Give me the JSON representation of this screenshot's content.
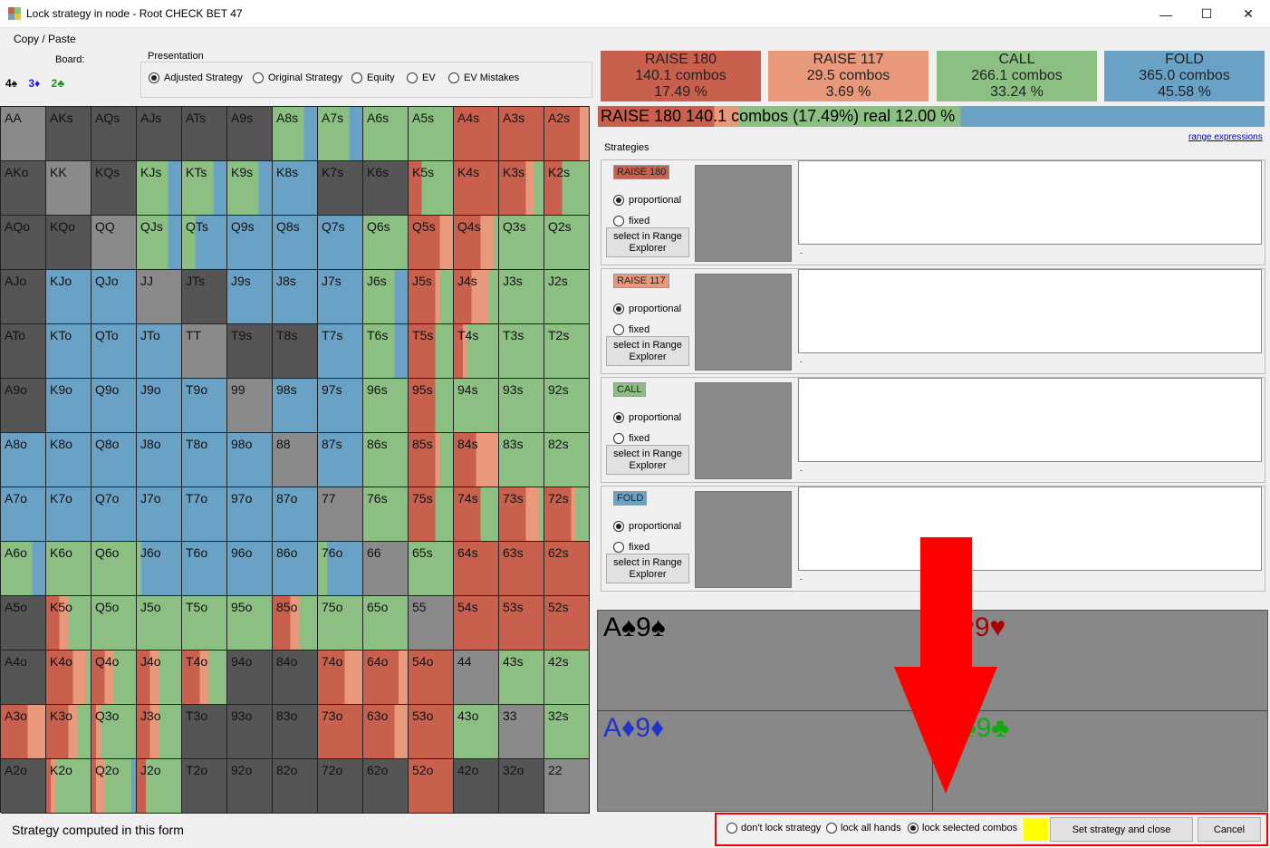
{
  "window": {
    "title": "Lock strategy in node  - Root CHECK BET 47",
    "minimize": "—",
    "maximize": "☐",
    "close": "✕"
  },
  "menu": {
    "copy_paste": "Copy / Paste"
  },
  "board": {
    "label": "Board:",
    "cards": [
      {
        "text": "4♠",
        "color": "#000000"
      },
      {
        "text": "3♦",
        "color": "#2222dd"
      },
      {
        "text": "2♣",
        "color": "#119911"
      }
    ]
  },
  "presentation": {
    "title": "Presentation",
    "options": [
      {
        "label": "Adjusted Strategy",
        "selected": true
      },
      {
        "label": "Original Strategy",
        "selected": false
      },
      {
        "label": "Equity",
        "selected": false
      },
      {
        "label": "EV",
        "selected": false
      },
      {
        "label": "EV Mistakes",
        "selected": false
      }
    ]
  },
  "colors": {
    "raise180": "#c9604e",
    "raise117": "#e8987b",
    "call": "#8cc083",
    "fold": "#6aa2c6",
    "empty": "#555555",
    "pair_empty": "#8a8a8a",
    "lock_color": "#ffff00"
  },
  "hands": [
    [
      "AA",
      "AKs",
      "AQs",
      "AJs",
      "ATs",
      "A9s",
      "A8s",
      "A7s",
      "A6s",
      "A5s",
      "A4s",
      "A3s",
      "A2s"
    ],
    [
      "AKo",
      "KK",
      "KQs",
      "KJs",
      "KTs",
      "K9s",
      "K8s",
      "K7s",
      "K6s",
      "K5s",
      "K4s",
      "K3s",
      "K2s"
    ],
    [
      "AQo",
      "KQo",
      "QQ",
      "QJs",
      "QTs",
      "Q9s",
      "Q8s",
      "Q7s",
      "Q6s",
      "Q5s",
      "Q4s",
      "Q3s",
      "Q2s"
    ],
    [
      "AJo",
      "KJo",
      "QJo",
      "JJ",
      "JTs",
      "J9s",
      "J8s",
      "J7s",
      "J6s",
      "J5s",
      "J4s",
      "J3s",
      "J2s"
    ],
    [
      "ATo",
      "KTo",
      "QTo",
      "JTo",
      "TT",
      "T9s",
      "T8s",
      "T7s",
      "T6s",
      "T5s",
      "T4s",
      "T3s",
      "T2s"
    ],
    [
      "A9o",
      "K9o",
      "Q9o",
      "J9o",
      "T9o",
      "99",
      "98s",
      "97s",
      "96s",
      "95s",
      "94s",
      "93s",
      "92s"
    ],
    [
      "A8o",
      "K8o",
      "Q8o",
      "J8o",
      "T8o",
      "98o",
      "88",
      "87s",
      "86s",
      "85s",
      "84s",
      "83s",
      "82s"
    ],
    [
      "A7o",
      "K7o",
      "Q7o",
      "J7o",
      "T7o",
      "97o",
      "87o",
      "77",
      "76s",
      "75s",
      "74s",
      "73s",
      "72s"
    ],
    [
      "A6o",
      "K6o",
      "Q6o",
      "J6o",
      "T6o",
      "96o",
      "86o",
      "76o",
      "66",
      "65s",
      "64s",
      "63s",
      "62s"
    ],
    [
      "A5o",
      "K5o",
      "Q5o",
      "J5o",
      "T5o",
      "95o",
      "85o",
      "75o",
      "65o",
      "55",
      "54s",
      "53s",
      "52s"
    ],
    [
      "A4o",
      "K4o",
      "Q4o",
      "J4o",
      "T4o",
      "94o",
      "84o",
      "74o",
      "64o",
      "54o",
      "44",
      "43s",
      "42s"
    ],
    [
      "A3o",
      "K3o",
      "Q3o",
      "J3o",
      "T3o",
      "93o",
      "83o",
      "73o",
      "63o",
      "53o",
      "43o",
      "33",
      "32s"
    ],
    [
      "A2o",
      "K2o",
      "Q2o",
      "J2o",
      "T2o",
      "92o",
      "82o",
      "72o",
      "62o",
      "52o",
      "42o",
      "32o",
      "22"
    ]
  ],
  "hand_mix_legend": "frequencies per hand as [raise180, raise117, call, fold]",
  "hand_mix": [
    [
      [
        0,
        0,
        0,
        0
      ],
      [
        0,
        0,
        0,
        0
      ],
      [
        0,
        0,
        0,
        0
      ],
      [
        0,
        0,
        0,
        0
      ],
      [
        0,
        0,
        0,
        0
      ],
      [
        0,
        0,
        0,
        0
      ],
      [
        0,
        0,
        0.7,
        0.3
      ],
      [
        0,
        0,
        0.7,
        0.3
      ],
      [
        0,
        0,
        1,
        0
      ],
      [
        0,
        0,
        1,
        0
      ],
      [
        1,
        0,
        0,
        0
      ],
      [
        1,
        0,
        0,
        0
      ],
      [
        0.8,
        0.2,
        0,
        0
      ]
    ],
    [
      [
        0,
        0,
        0,
        0
      ],
      [
        0,
        0,
        0,
        0
      ],
      [
        0,
        0,
        0,
        0
      ],
      [
        0,
        0,
        0.7,
        0.3
      ],
      [
        0,
        0,
        0.7,
        0.3
      ],
      [
        0,
        0,
        0.7,
        0.3
      ],
      [
        0,
        0,
        0,
        1
      ],
      [
        0,
        0,
        0,
        0
      ],
      [
        0,
        0,
        0,
        0
      ],
      [
        0.3,
        0,
        0.7,
        0
      ],
      [
        1,
        0,
        0,
        0
      ],
      [
        0.6,
        0.2,
        0.2,
        0
      ],
      [
        0.4,
        0,
        0.6,
        0
      ]
    ],
    [
      [
        0,
        0,
        0,
        0
      ],
      [
        0,
        0,
        0,
        0
      ],
      [
        0,
        0,
        0,
        0
      ],
      [
        0,
        0,
        0.7,
        0.3
      ],
      [
        0,
        0,
        0.3,
        0.7
      ],
      [
        0,
        0,
        0,
        1
      ],
      [
        0,
        0,
        0,
        1
      ],
      [
        0,
        0,
        0,
        1
      ],
      [
        0,
        0,
        1,
        0
      ],
      [
        0.7,
        0.3,
        0,
        0
      ],
      [
        0.6,
        0.3,
        0.1,
        0
      ],
      [
        0,
        0,
        1,
        0
      ],
      [
        0,
        0,
        1,
        0
      ]
    ],
    [
      [
        0,
        0,
        0,
        0
      ],
      [
        0,
        0,
        0,
        1
      ],
      [
        0,
        0,
        0,
        1
      ],
      [
        0,
        0,
        0,
        0
      ],
      [
        0,
        0,
        0,
        0
      ],
      [
        0,
        0,
        0,
        1
      ],
      [
        0,
        0,
        0,
        1
      ],
      [
        0,
        0,
        0,
        1
      ],
      [
        0,
        0,
        0.7,
        0.3
      ],
      [
        0.6,
        0.1,
        0.3,
        0
      ],
      [
        0.4,
        0.4,
        0.2,
        0
      ],
      [
        0,
        0,
        1,
        0
      ],
      [
        0,
        0,
        1,
        0
      ]
    ],
    [
      [
        0,
        0,
        0,
        0
      ],
      [
        0,
        0,
        0,
        1
      ],
      [
        0,
        0,
        0,
        1
      ],
      [
        0,
        0,
        0,
        1
      ],
      [
        0,
        0,
        0,
        0
      ],
      [
        0,
        0,
        0,
        0
      ],
      [
        0,
        0,
        0,
        0
      ],
      [
        0,
        0,
        0,
        1
      ],
      [
        0,
        0,
        0.7,
        0.3
      ],
      [
        0.6,
        0,
        0.4,
        0
      ],
      [
        0.2,
        0.1,
        0.7,
        0
      ],
      [
        0,
        0,
        1,
        0
      ],
      [
        0,
        0,
        1,
        0
      ]
    ],
    [
      [
        0,
        0,
        0,
        0
      ],
      [
        0,
        0,
        0,
        1
      ],
      [
        0,
        0,
        0,
        1
      ],
      [
        0,
        0,
        0,
        1
      ],
      [
        0,
        0,
        0,
        1
      ],
      [
        0,
        0,
        0,
        0
      ],
      [
        0,
        0,
        0,
        1
      ],
      [
        0,
        0,
        0,
        1
      ],
      [
        0,
        0,
        1,
        0
      ],
      [
        0.6,
        0,
        0.4,
        0
      ],
      [
        0,
        0,
        1,
        0
      ],
      [
        0,
        0,
        1,
        0
      ],
      [
        0,
        0,
        1,
        0
      ]
    ],
    [
      [
        0,
        0,
        0,
        1
      ],
      [
        0,
        0,
        0,
        1
      ],
      [
        0,
        0,
        0,
        1
      ],
      [
        0,
        0,
        0,
        1
      ],
      [
        0,
        0,
        0,
        1
      ],
      [
        0,
        0,
        0,
        1
      ],
      [
        0,
        0,
        0,
        0
      ],
      [
        0,
        0,
        0,
        1
      ],
      [
        0,
        0,
        1,
        0
      ],
      [
        0.6,
        0.1,
        0.3,
        0
      ],
      [
        0.5,
        0.5,
        0,
        0
      ],
      [
        0,
        0,
        1,
        0
      ],
      [
        0,
        0,
        1,
        0
      ]
    ],
    [
      [
        0,
        0,
        0,
        1
      ],
      [
        0,
        0,
        0,
        1
      ],
      [
        0,
        0,
        0,
        1
      ],
      [
        0,
        0,
        0,
        1
      ],
      [
        0,
        0,
        0,
        1
      ],
      [
        0,
        0,
        0,
        1
      ],
      [
        0,
        0,
        0,
        1
      ],
      [
        0,
        0,
        0,
        0
      ],
      [
        0,
        0,
        1,
        0
      ],
      [
        0.6,
        0,
        0.4,
        0
      ],
      [
        0.6,
        0,
        0.4,
        0
      ],
      [
        0.6,
        0.3,
        0.1,
        0
      ],
      [
        0.6,
        0.1,
        0.3,
        0
      ]
    ],
    [
      [
        0,
        0,
        0.7,
        0.3
      ],
      [
        0,
        0,
        1,
        0
      ],
      [
        0,
        0,
        1,
        0
      ],
      [
        0,
        0,
        0.1,
        0.9
      ],
      [
        0,
        0,
        0,
        1
      ],
      [
        0,
        0,
        0,
        1
      ],
      [
        0,
        0,
        0,
        1
      ],
      [
        0,
        0,
        0.2,
        0.8
      ],
      [
        0,
        0,
        0,
        0
      ],
      [
        0,
        0,
        1,
        0
      ],
      [
        1,
        0,
        0,
        0
      ],
      [
        1,
        0,
        0,
        0
      ],
      [
        1,
        0,
        0,
        0
      ]
    ],
    [
      [
        0,
        0,
        0,
        0
      ],
      [
        0.3,
        0.2,
        0.5,
        0
      ],
      [
        0,
        0,
        1,
        0
      ],
      [
        0,
        0,
        1,
        0
      ],
      [
        0,
        0,
        1,
        0
      ],
      [
        0,
        0,
        1,
        0
      ],
      [
        0.4,
        0.2,
        0.4,
        0
      ],
      [
        0,
        0,
        1,
        0
      ],
      [
        0,
        0,
        1,
        0
      ],
      [
        0,
        0,
        0,
        0
      ],
      [
        1,
        0,
        0,
        0
      ],
      [
        1,
        0,
        0,
        0
      ],
      [
        1,
        0,
        0,
        0
      ]
    ],
    [
      [
        0,
        0,
        0,
        0
      ],
      [
        0.6,
        0.3,
        0.1,
        0
      ],
      [
        0.3,
        0.2,
        0.5,
        0
      ],
      [
        0.3,
        0.2,
        0.5,
        0
      ],
      [
        0.4,
        0.2,
        0.4,
        0
      ],
      [
        0,
        0,
        0,
        0
      ],
      [
        0,
        0,
        0,
        0
      ],
      [
        0.6,
        0.4,
        0,
        0
      ],
      [
        0.8,
        0.2,
        0,
        0
      ],
      [
        1,
        0,
        0,
        0
      ],
      [
        0,
        0,
        0,
        0
      ],
      [
        0,
        0,
        1,
        0
      ],
      [
        0,
        0,
        1,
        0
      ]
    ],
    [
      [
        0.6,
        0.4,
        0,
        0
      ],
      [
        0.5,
        0.2,
        0.3,
        0
      ],
      [
        0.1,
        0.1,
        0.8,
        0
      ],
      [
        0.3,
        0.2,
        0.5,
        0
      ],
      [
        0,
        0,
        0,
        0
      ],
      [
        0,
        0,
        0,
        0
      ],
      [
        0,
        0,
        0,
        0
      ],
      [
        1,
        0,
        0,
        0
      ],
      [
        0.7,
        0.3,
        0,
        0
      ],
      [
        1,
        0,
        0,
        0
      ],
      [
        0,
        0,
        1,
        0
      ],
      [
        0,
        0,
        0,
        0
      ],
      [
        0,
        0,
        1,
        0
      ]
    ],
    [
      [
        0,
        0,
        0,
        0
      ],
      [
        0.1,
        0.1,
        0.8,
        0
      ],
      [
        0.1,
        0.2,
        0.6,
        0.1
      ],
      [
        0.2,
        0,
        0.8,
        0
      ],
      [
        0,
        0,
        0,
        0
      ],
      [
        0,
        0,
        0,
        0
      ],
      [
        0,
        0,
        0,
        0
      ],
      [
        0,
        0,
        0,
        0
      ],
      [
        0,
        0,
        0,
        0
      ],
      [
        1,
        0,
        0,
        0
      ],
      [
        0,
        0,
        0,
        0
      ],
      [
        0,
        0,
        0,
        0
      ],
      [
        0,
        0,
        0,
        0
      ]
    ]
  ],
  "actions": [
    {
      "name": "RAISE 180",
      "combos": "140.1 combos",
      "pct": "17.49 %",
      "color": "#c9604e"
    },
    {
      "name": "RAISE 117",
      "combos": "29.5 combos",
      "pct": "3.69 %",
      "color": "#e8987b"
    },
    {
      "name": "CALL",
      "combos": "266.1 combos",
      "pct": "33.24 %",
      "color": "#8cc083"
    },
    {
      "name": "FOLD",
      "combos": "365.0 combos",
      "pct": "45.58 %",
      "color": "#6aa2c6"
    }
  ],
  "status": {
    "text": "RAISE 180   140.1 combos (17.49%) real  12.00 %",
    "segments": [
      0.1749,
      0.0369,
      0.3324,
      0.4558
    ]
  },
  "range_link": "range expressions",
  "strategies_label": "Strategies",
  "strategies": [
    {
      "tag": "RAISE 180",
      "color": "#c9604e",
      "proportional": "proportional",
      "fixed": "fixed",
      "select_btn": "select in Range Explorer",
      "dash": "-"
    },
    {
      "tag": "RAISE 117",
      "color": "#e8987b",
      "proportional": "proportional",
      "fixed": "fixed",
      "select_btn": "select in Range Explorer",
      "dash": "-"
    },
    {
      "tag": "CALL",
      "color": "#8cc083",
      "proportional": "proportional",
      "fixed": "fixed",
      "select_btn": "select in Range Explorer",
      "dash": "-"
    },
    {
      "tag": "FOLD",
      "color": "#6aa2c6",
      "proportional": "proportional",
      "fixed": "fixed",
      "select_btn": "select in Range Explorer",
      "dash": "-"
    }
  ],
  "combo_cards": [
    {
      "text": "A♠9♠",
      "color": "#000000"
    },
    {
      "text": "A♥9♥",
      "color": "#aa0000"
    },
    {
      "text": "A♦9♦",
      "color": "#2233cc"
    },
    {
      "text": "A♣9♣",
      "color": "#11aa11"
    }
  ],
  "footer": {
    "computed_text": "Strategy computed in this form",
    "lock_options": [
      {
        "label": "don't lock strategy",
        "selected": false
      },
      {
        "label": "lock all hands",
        "selected": false
      },
      {
        "label": "lock selected combos",
        "selected": true
      }
    ],
    "set_close": "Set strategy and close",
    "cancel": "Cancel"
  }
}
